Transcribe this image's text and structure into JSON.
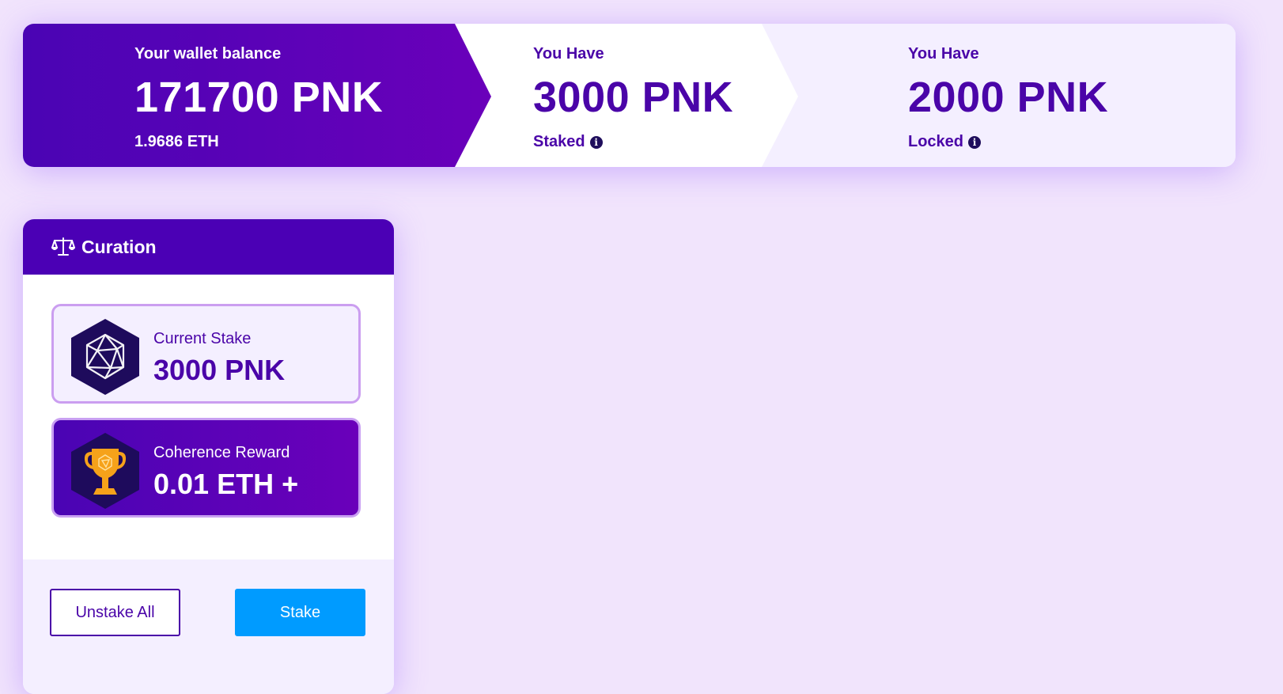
{
  "banner": {
    "wallet": {
      "label": "Your wallet balance",
      "amount": "171700 PNK",
      "eth": "1.9686 ETH"
    },
    "staked": {
      "label": "You Have",
      "amount": "3000 PNK",
      "sub": "Staked",
      "icon": "info-icon"
    },
    "locked": {
      "label": "You Have",
      "amount": "2000 PNK",
      "sub": "Locked",
      "icon": "info-icon"
    }
  },
  "curation": {
    "title": "Curation",
    "icon": "scale-icon",
    "current_stake": {
      "label": "Current Stake",
      "value": "3000 PNK",
      "icon": "icosahedron-icon"
    },
    "coherence_reward": {
      "label": "Coherence Reward",
      "value": "0.01 ETH +",
      "icon": "trophy-icon"
    },
    "buttons": {
      "unstake_all": "Unstake All",
      "stake": "Stake"
    }
  },
  "colors": {
    "page_bg": "#f1e4fc",
    "primary_purple": "#4b00b5",
    "text_purple": "#4a04a8",
    "stake_button": "#009bff",
    "trophy": "#f6a21a"
  }
}
